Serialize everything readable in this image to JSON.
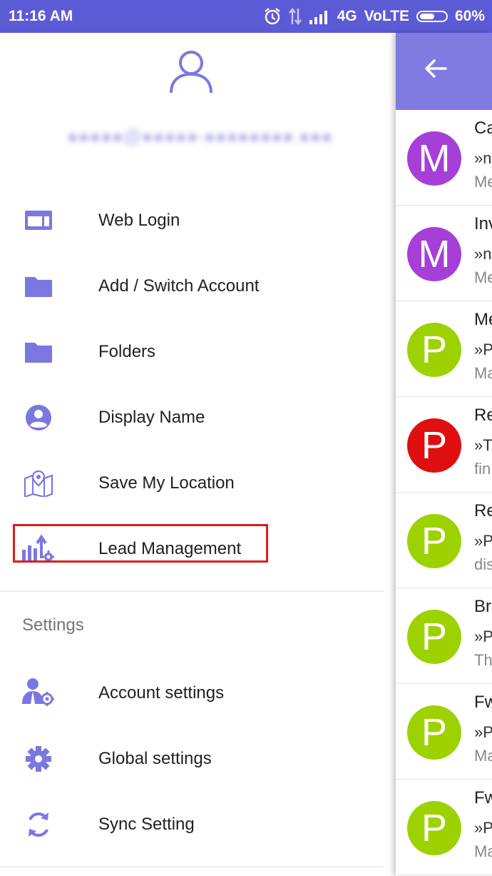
{
  "status_bar": {
    "time": "11:16 AM",
    "network": "4G",
    "volte": "VoLTE",
    "battery": "60%",
    "battery_level": 0.6
  },
  "drawer": {
    "items": [
      {
        "label": "Web Login",
        "icon": "web-login-icon"
      },
      {
        "label": "Add / Switch Account",
        "icon": "folder-icon"
      },
      {
        "label": "Folders",
        "icon": "folder-icon"
      },
      {
        "label": "Display Name",
        "icon": "account-circle-icon"
      },
      {
        "label": "Save My Location",
        "icon": "map-location-icon"
      },
      {
        "label": "Lead Management",
        "icon": "lead-chart-icon"
      }
    ],
    "settings_title": "Settings",
    "settings_items": [
      {
        "label": "Account settings",
        "icon": "account-settings-icon"
      },
      {
        "label": "Global settings",
        "icon": "gear-icon"
      },
      {
        "label": "Sync Setting",
        "icon": "sync-icon"
      }
    ]
  },
  "emails": [
    {
      "letter": "M",
      "color": "#a53fd8",
      "subject": "Ca",
      "preview": "»n",
      "snippet": "Me"
    },
    {
      "letter": "M",
      "color": "#a53fd8",
      "subject": "Inv",
      "preview": "»n",
      "snippet": "Me"
    },
    {
      "letter": "P",
      "color": "#9ed100",
      "subject": "Me",
      "preview": "»P",
      "snippet": "Ma"
    },
    {
      "letter": "P",
      "color": "#e00f0f",
      "subject": "Re",
      "preview": "»T",
      "snippet": "fin"
    },
    {
      "letter": "P",
      "color": "#9ed100",
      "subject": "Re",
      "preview": "»P",
      "snippet": "dis"
    },
    {
      "letter": "P",
      "color": "#9ed100",
      "subject": "Br",
      "preview": "»P",
      "snippet": "Th"
    },
    {
      "letter": "P",
      "color": "#9ed100",
      "subject": "Fw",
      "preview": "»P",
      "snippet": "Ma"
    },
    {
      "letter": "P",
      "color": "#9ed100",
      "subject": "Fw",
      "preview": "»P",
      "snippet": "Ma"
    }
  ],
  "colors": {
    "accent": "#7a78e0",
    "status_bar": "#5c5bd6",
    "highlight": "#e0191b"
  }
}
